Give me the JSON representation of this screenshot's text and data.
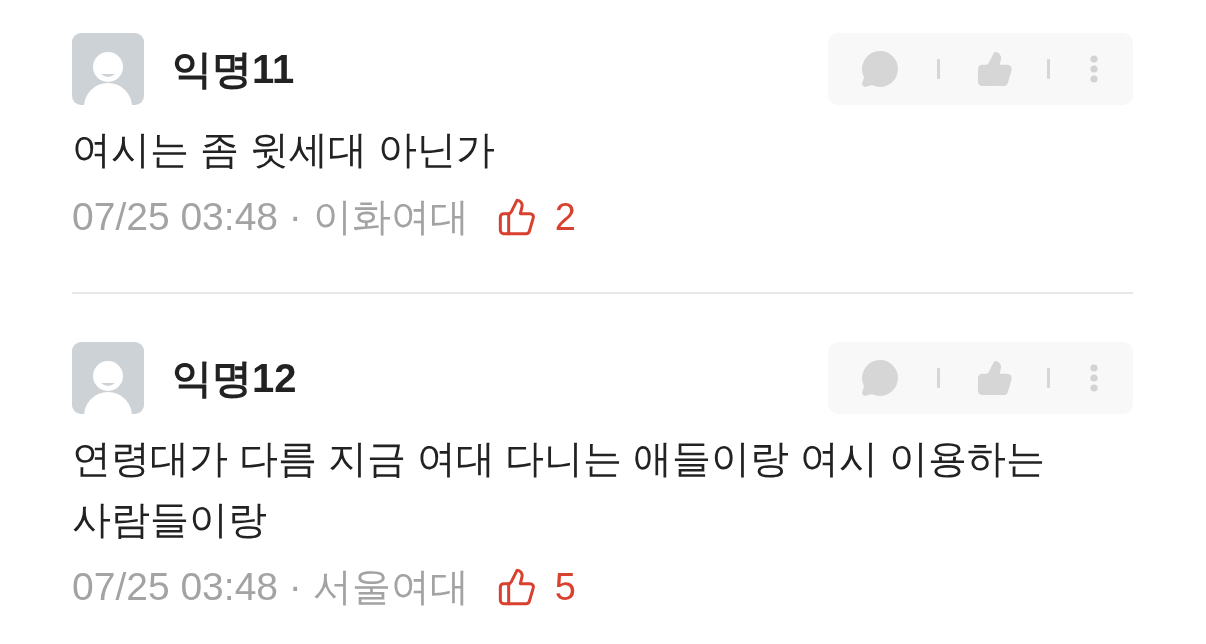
{
  "comments": [
    {
      "author": "익명11",
      "body": "여시는 좀 윗세대 아닌가",
      "meta": "07/25 03:48 · 이화여대",
      "likes": "2"
    },
    {
      "author": "익명12",
      "body": "연령대가 다름 지금 여대 다니는 애들이랑 여시 이용하는 사람들이랑",
      "meta": "07/25 03:48 · 서울여대",
      "likes": "5"
    }
  ]
}
